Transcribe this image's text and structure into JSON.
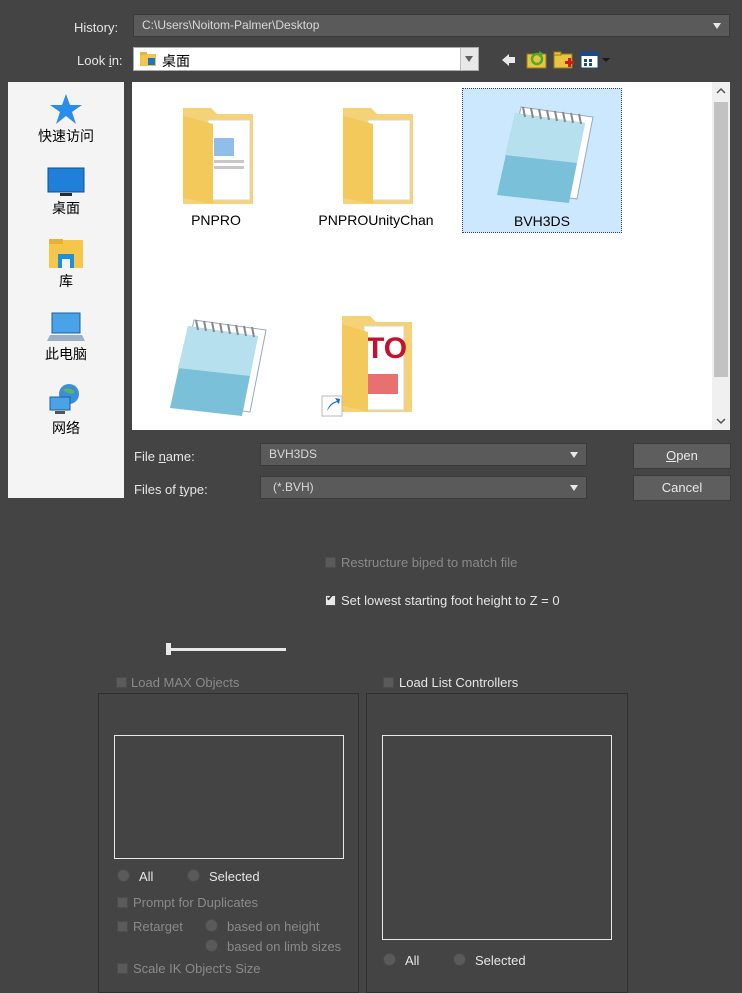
{
  "history": {
    "label": "History:",
    "value": "C:\\Users\\Noitom-Palmer\\Desktop"
  },
  "lookin": {
    "label_pre": "Look ",
    "label_ul": "i",
    "label_post": "n:",
    "value": "桌面"
  },
  "toolbar": {
    "back_icon": "back-arrow-icon",
    "up_icon": "up-folder-icon",
    "newfolder_icon": "new-folder-icon",
    "view_icon": "view-menu-icon"
  },
  "sidebar": {
    "items": [
      {
        "label": "快速访问",
        "icon": "star-icon"
      },
      {
        "label": "桌面",
        "icon": "desktop-icon"
      },
      {
        "label": "库",
        "icon": "library-icon"
      },
      {
        "label": "此电脑",
        "icon": "computer-icon"
      },
      {
        "label": "网络",
        "icon": "network-icon"
      }
    ]
  },
  "files": [
    {
      "name": "PNPRO",
      "type": "folder"
    },
    {
      "name": "PNPROUnityChan",
      "type": "folder"
    },
    {
      "name": "BVH3DS",
      "type": "notepad",
      "selected": true
    },
    {
      "name": "",
      "type": "notepad"
    },
    {
      "name": "",
      "type": "shortcut-folder"
    }
  ],
  "filename": {
    "label_pre": "File ",
    "label_ul": "n",
    "label_post": "ame:",
    "value": "BVH3DS"
  },
  "filetype": {
    "label_pre": "Files of ",
    "label_ul": "t",
    "label_post": "ype:",
    "value": "(*.BVH)"
  },
  "buttons": {
    "open_pre": "",
    "open_ul": "O",
    "open_post": "pen",
    "cancel": "Cancel"
  },
  "options": {
    "restructure": "Restructure biped to match file",
    "set_lowest": "Set lowest starting foot height to Z = 0",
    "load_max": "Load MAX Objects",
    "load_list": "Load List Controllers",
    "all1": "All",
    "selected1": "Selected",
    "prompt_dup": "Prompt for Duplicates",
    "retarget": "Retarget",
    "based_height": "based on height",
    "based_limb": "based on limb sizes",
    "scale_ik": "Scale IK Object's Size",
    "all2": "All",
    "selected2": "Selected"
  },
  "colors": {
    "bg": "#444444",
    "selection": "#cce8ff"
  }
}
